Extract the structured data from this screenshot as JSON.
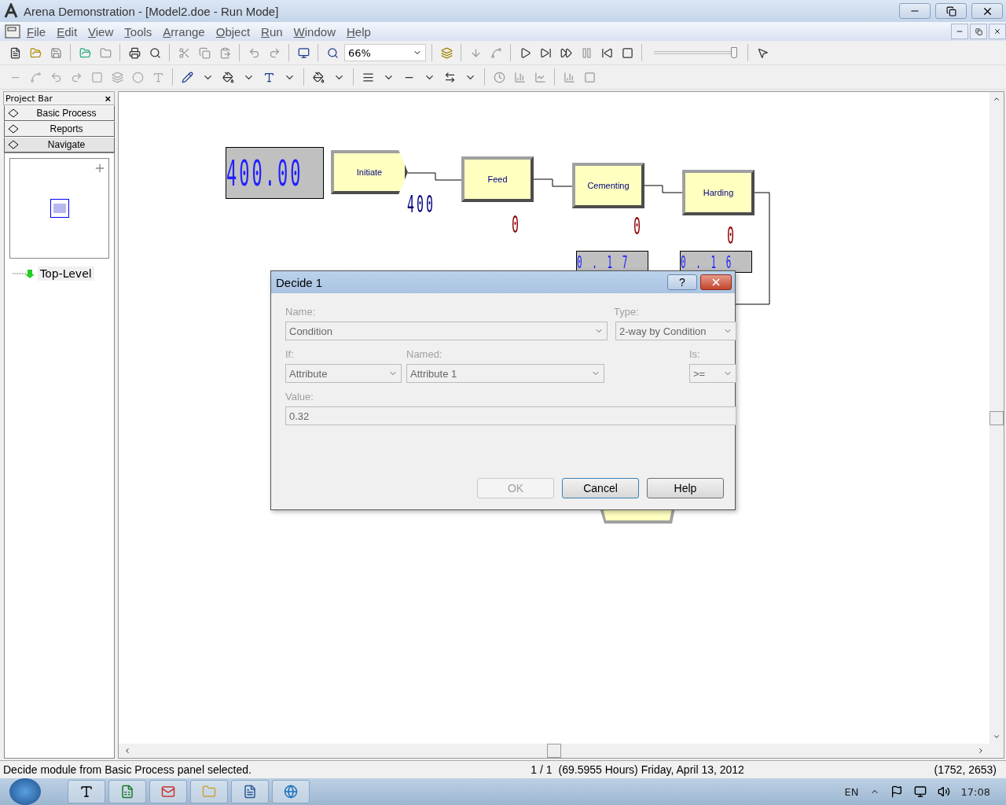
{
  "window": {
    "title": "Arena Demonstration - [Model2.doe - Run Mode]"
  },
  "menu": [
    "File",
    "Edit",
    "View",
    "Tools",
    "Arrange",
    "Object",
    "Run",
    "Window",
    "Help"
  ],
  "toolbar": {
    "zoom": "66%",
    "speed_slider": {
      "level": 0.97
    }
  },
  "project_bar": {
    "title": "Project Bar",
    "close": "×",
    "panels": [
      {
        "label": "Basic Process",
        "selected": false
      },
      {
        "label": "Reports",
        "selected": false
      },
      {
        "label": "Navigate",
        "selected": true
      }
    ],
    "tree": [
      {
        "label": "Top-Level",
        "selected": true
      }
    ]
  },
  "canvas": {
    "displays": [
      {
        "value": "400.00"
      },
      {
        "value": "0 . 1 7"
      },
      {
        "value": "0 . 1 6"
      }
    ],
    "modules": [
      {
        "kind": "create",
        "label": "Initiate",
        "counter": "400"
      },
      {
        "kind": "process",
        "label": "Feed",
        "counter": "0"
      },
      {
        "kind": "process",
        "label": "Cementing",
        "counter": "0"
      },
      {
        "kind": "process",
        "label": "Harding",
        "counter": "0"
      }
    ]
  },
  "dialog": {
    "title": "Decide 1",
    "help": "?",
    "fields": [
      {
        "label": "Name:",
        "value": "Condition"
      },
      {
        "label": "Type:",
        "value": "2-way by Condition"
      },
      {
        "label": "If:",
        "value": "Attribute"
      },
      {
        "label": "Named:",
        "value": "Attribute 1"
      },
      {
        "label": "Is:",
        "value": ">="
      },
      {
        "label": "Value:",
        "value": "0.32"
      }
    ],
    "buttons": [
      {
        "label": "OK",
        "disabled": true,
        "focused": false
      },
      {
        "label": "Cancel",
        "disabled": false,
        "focused": true
      },
      {
        "label": "Help",
        "disabled": false,
        "focused": false
      }
    ]
  },
  "status_bar": [
    "Decide module from Basic Process panel selected.",
    "1 / 1",
    "(69.5955 Hours) Friday, April 13, 2012",
    "(1752, 2653)"
  ],
  "taskbar": {
    "language": "EN",
    "clock": "17:08"
  }
}
